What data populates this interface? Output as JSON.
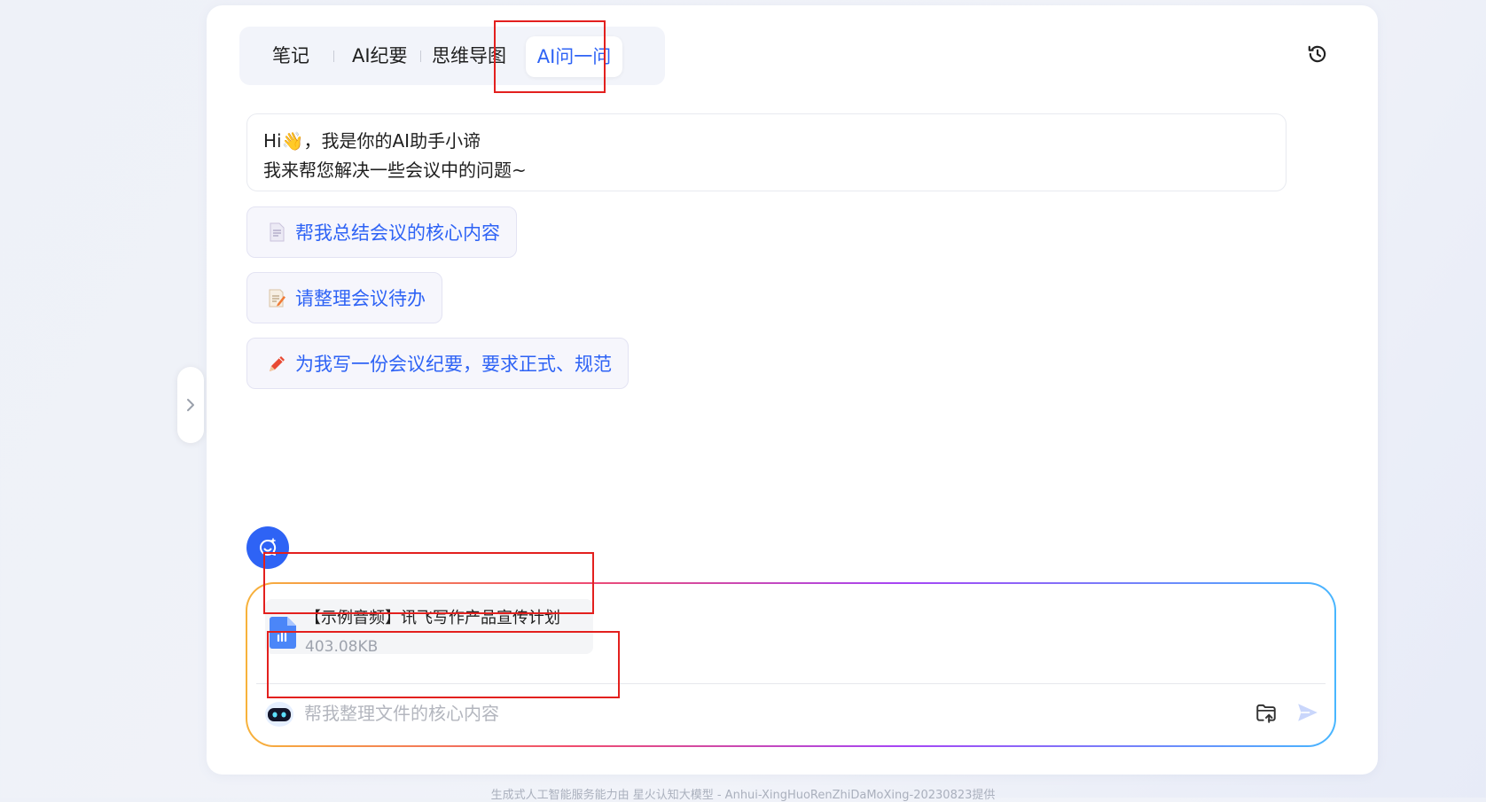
{
  "tabs": [
    {
      "label": "笔记"
    },
    {
      "label": "AI纪要"
    },
    {
      "label": "思维导图"
    },
    {
      "label": "AI问一问"
    }
  ],
  "greeting": {
    "line1": "Hi👋，我是你的AI助手小谛",
    "line2": "我来帮您解决一些会议中的问题~"
  },
  "suggestions": [
    {
      "icon": "document-icon",
      "label": "帮我总结会议的核心内容"
    },
    {
      "icon": "memo-icon",
      "label": "请整理会议待办"
    },
    {
      "icon": "pencil-icon",
      "label": "为我写一份会议纪要，要求正式、规范"
    }
  ],
  "file": {
    "name": "【示例音频】讯飞写作产品宣传计划",
    "size": "403.08KB"
  },
  "input": {
    "placeholder": "帮我整理文件的核心内容"
  },
  "footer": {
    "text": "生成式人工智能服务能力由 星火认知大模型 - Anhui-XingHuoRenZhiDaMoXing-20230823提供"
  },
  "colors": {
    "accent": "#2e63f5",
    "highlight": "#e3201e"
  }
}
